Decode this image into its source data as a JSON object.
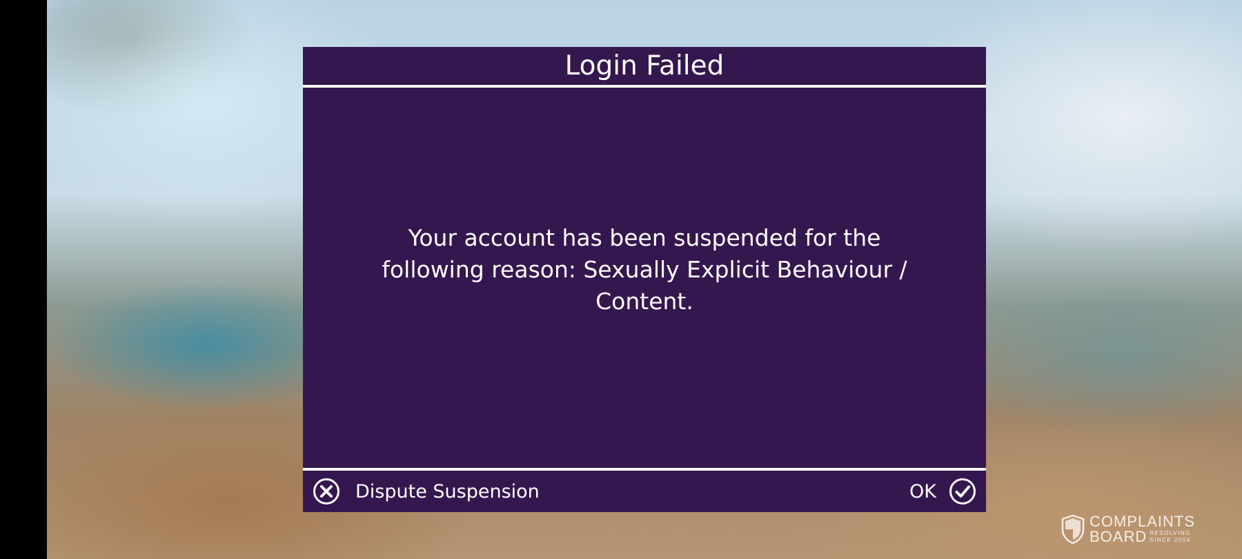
{
  "dialog": {
    "title": "Login Failed",
    "message": "Your account has been suspended for the following reason: Sexually Explicit Behaviour / Content.",
    "dispute_button": {
      "label": "Dispute Suspension",
      "icon": "x-circle-icon"
    },
    "ok_button": {
      "label": "OK",
      "icon": "check-circle-icon"
    }
  },
  "watermark": {
    "line1": "COMPLAINTS",
    "line2": "BOARD",
    "tagline": "RESOLVING SINCE 2004",
    "icon": "shield-icon"
  },
  "colors": {
    "dialog_background": "#35174f",
    "divider": "#ffffff",
    "text": "#ffffff"
  }
}
